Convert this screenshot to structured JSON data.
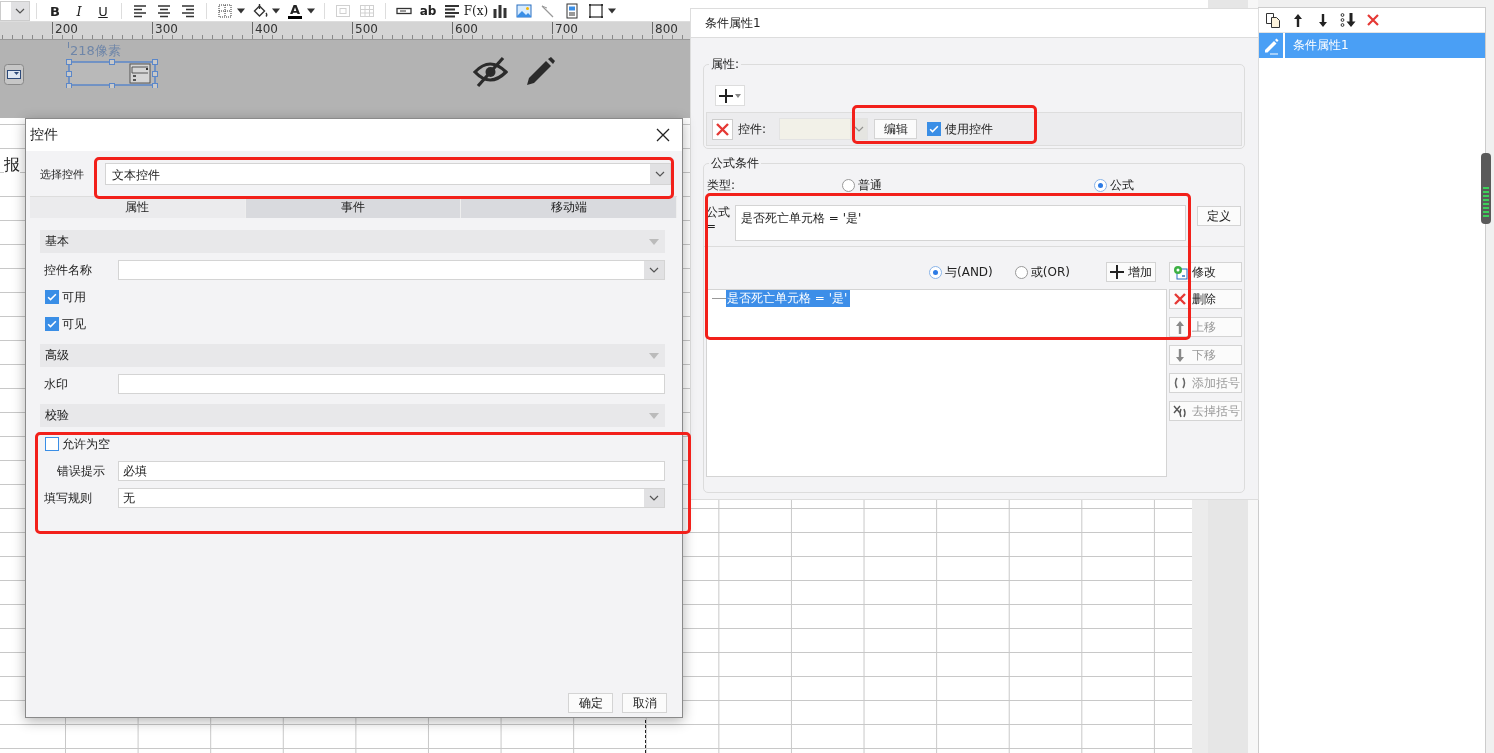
{
  "toolbar": {
    "groups": [
      [
        {
          "kind": "combo",
          "menu": false,
          "disabled": false
        }
      ],
      [
        {
          "kind": "bold",
          "label": "B",
          "menu": false,
          "disabled": false
        },
        {
          "kind": "italic",
          "label": "I",
          "menu": false,
          "disabled": false
        },
        {
          "kind": "underline",
          "label": "U",
          "menu": false,
          "disabled": false
        }
      ],
      [
        {
          "kind": "align-left",
          "menu": false,
          "disabled": false
        },
        {
          "kind": "align-center",
          "menu": false,
          "disabled": false
        },
        {
          "kind": "align-right",
          "menu": false,
          "disabled": false
        }
      ],
      [
        {
          "kind": "border",
          "menu": true,
          "disabled": false
        },
        {
          "kind": "fill",
          "menu": true,
          "disabled": false
        },
        {
          "kind": "font-color",
          "label": "A",
          "menu": true,
          "disabled": false
        }
      ],
      [
        {
          "kind": "merge",
          "menu": false,
          "disabled": true
        },
        {
          "kind": "table",
          "menu": false,
          "disabled": true
        }
      ],
      [
        {
          "kind": "text-field",
          "menu": false,
          "disabled": false
        },
        {
          "kind": "text",
          "label": "ab",
          "menu": false,
          "disabled": false
        },
        {
          "kind": "paragraph",
          "menu": false,
          "disabled": false
        },
        {
          "kind": "formula",
          "label": "F(x)",
          "menu": false,
          "disabled": false
        },
        {
          "kind": "chart",
          "menu": false,
          "disabled": false
        },
        {
          "kind": "image",
          "menu": false,
          "disabled": false
        },
        {
          "kind": "slash",
          "menu": false,
          "disabled": false
        },
        {
          "kind": "document",
          "menu": false,
          "disabled": false
        },
        {
          "kind": "frame",
          "menu": true,
          "disabled": false
        }
      ]
    ]
  },
  "ruler": {
    "ticks": [
      "200",
      "300",
      "400",
      "500",
      "600",
      "700",
      "800"
    ]
  },
  "design_area": {
    "width_label": "218像素"
  },
  "sheet": {
    "cell_text": "报"
  },
  "control_dialog": {
    "title": "控件",
    "type_label": "选择控件",
    "type_value": "文本控件",
    "tabs": [
      {
        "label": "属性",
        "selected": true
      },
      {
        "label": "事件",
        "selected": false
      },
      {
        "label": "移动端",
        "selected": false
      }
    ],
    "sections": [
      {
        "title": "基本",
        "rows": [
          {
            "kind": "combo",
            "label": "控件名称"
          },
          {
            "kind": "checkbox",
            "label": "可用",
            "checked": true
          },
          {
            "kind": "checkbox",
            "label": "可见",
            "checked": true
          }
        ]
      },
      {
        "title": "高级",
        "rows": [
          {
            "kind": "field",
            "label": "水印"
          }
        ]
      },
      {
        "title": "校验",
        "rows": [
          {
            "kind": "checkbox",
            "label": "允许为空",
            "checked": false,
            "children": [
              {
                "kind": "field",
                "label": "错误提示",
                "value": "必填"
              }
            ]
          },
          {
            "kind": "combo",
            "label": "填写规则",
            "value": "无"
          }
        ]
      }
    ],
    "buttons": [
      "确定",
      "取消"
    ]
  },
  "condition_panel": {
    "title": "条件属性1",
    "property_group": {
      "legend": "属性:",
      "control_label": "控件:",
      "edit_button": "编辑",
      "use_control": {
        "label": "使用控件",
        "checked": true
      }
    },
    "formula_group": {
      "legend": "公式条件",
      "type_label": "类型:",
      "types": [
        {
          "label": "普通",
          "selected": false
        },
        {
          "label": "公式",
          "selected": true
        }
      ],
      "formula_label": "公式=",
      "formula_value": "是否死亡单元格 = '是'",
      "define_button": "定义",
      "logic": [
        {
          "label": "与(AND)",
          "selected": true
        },
        {
          "label": "或(OR)",
          "selected": false
        }
      ],
      "add_button": "增加",
      "conditions": [
        {
          "text": "是否死亡单元格 = '是'",
          "selected": true
        }
      ],
      "actions": [
        {
          "kind": "modify",
          "label": "修改",
          "disabled": false
        },
        {
          "kind": "delete",
          "label": "删除",
          "disabled": false
        },
        {
          "kind": "up",
          "label": "上移",
          "disabled": true
        },
        {
          "kind": "down",
          "label": "下移",
          "disabled": true
        },
        {
          "kind": "add-brackets",
          "label": "添加括号",
          "disabled": true
        },
        {
          "kind": "remove-brackets",
          "label": "去掉括号",
          "disabled": true
        }
      ]
    }
  },
  "condition_list": {
    "toolbar": [
      {
        "kind": "copy"
      },
      {
        "kind": "up"
      },
      {
        "kind": "down"
      },
      {
        "kind": "bottom"
      },
      {
        "kind": "delete"
      }
    ],
    "items": [
      {
        "label": "条件属性1",
        "selected": true
      }
    ]
  }
}
